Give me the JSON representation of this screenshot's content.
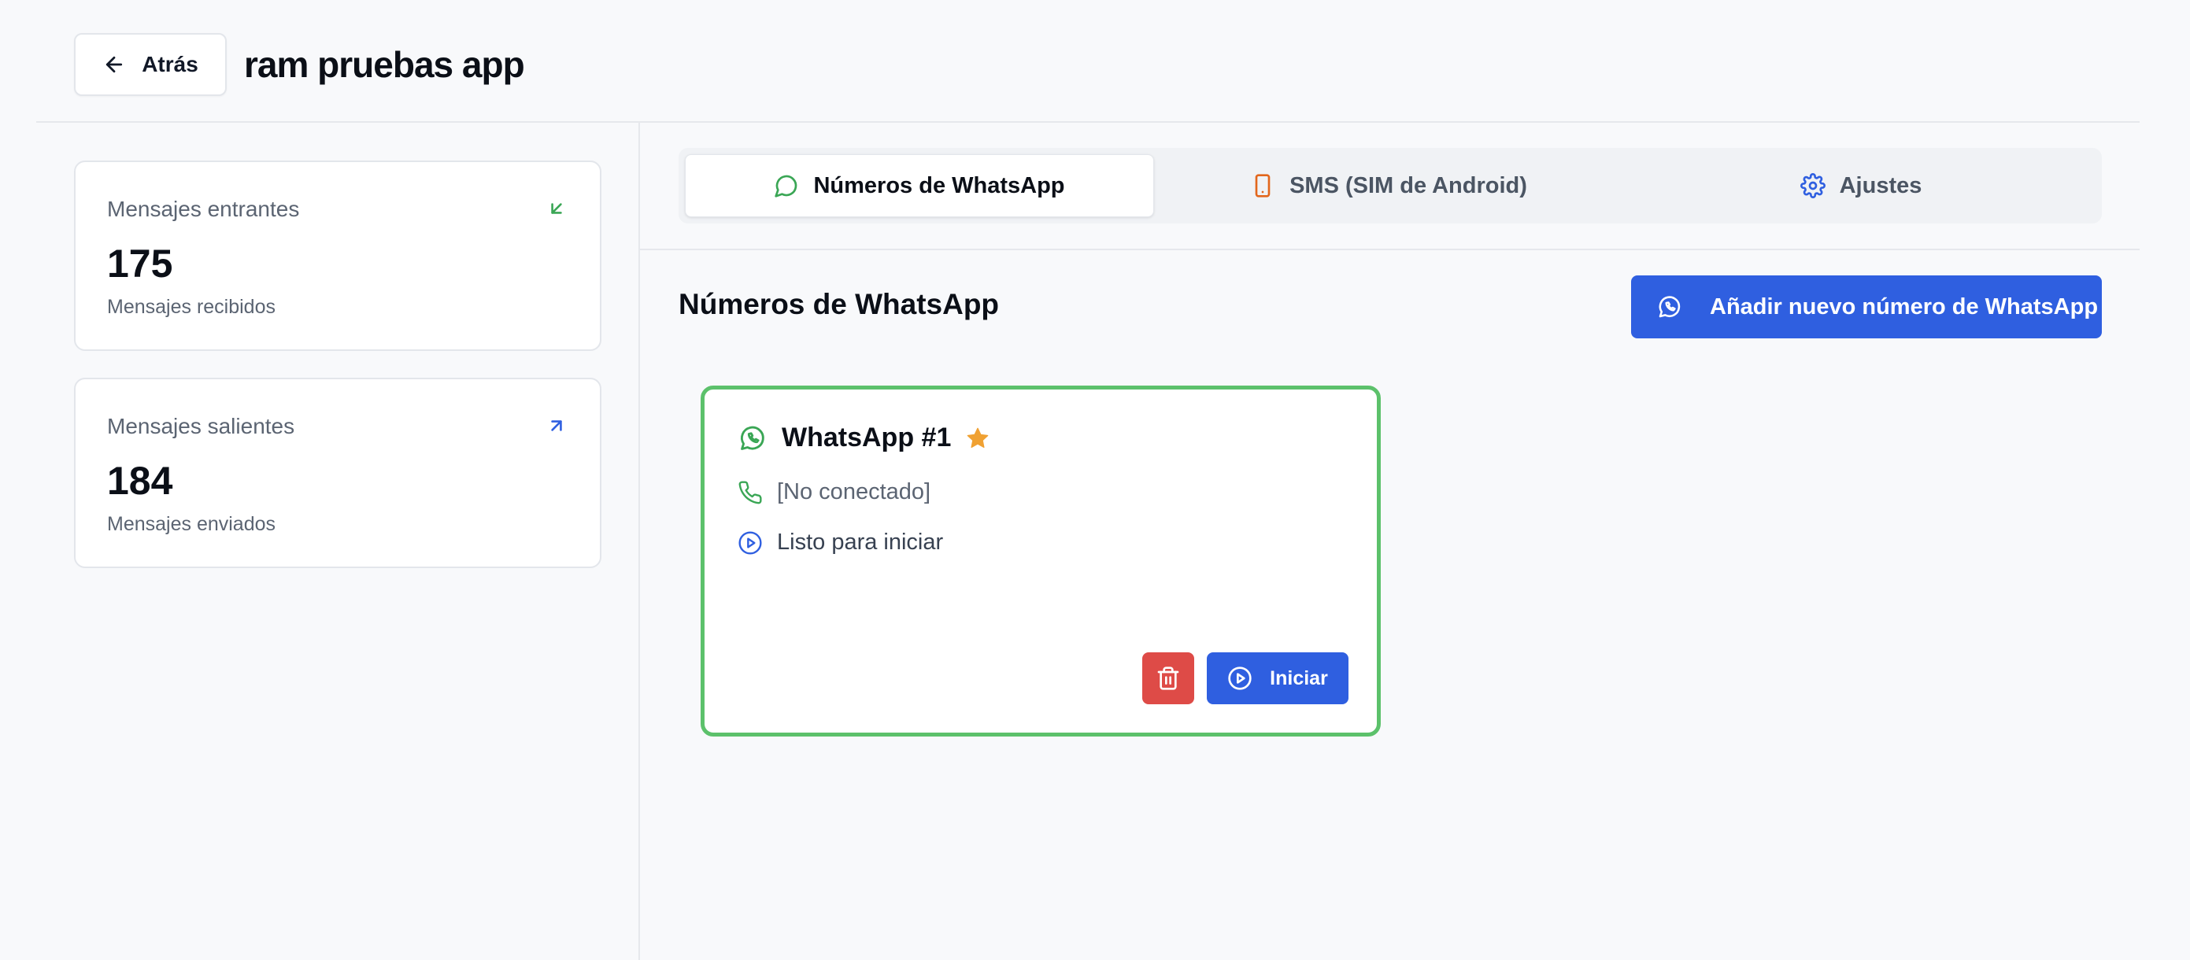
{
  "header": {
    "back_label": "Atrás",
    "title": "ram pruebas app"
  },
  "stats": {
    "incoming": {
      "label": "Mensajes entrantes",
      "value": "175",
      "sub": "Mensajes recibidos",
      "icon": "arrow-down-left-icon",
      "color": "#3aa655"
    },
    "outgoing": {
      "label": "Mensajes salientes",
      "value": "184",
      "sub": "Mensajes enviados",
      "icon": "arrow-up-right-icon",
      "color": "#2f5fe0"
    }
  },
  "tabs": [
    {
      "label": "Números de WhatsApp",
      "icon": "message-circle-icon",
      "active": true,
      "color": "#3aa655"
    },
    {
      "label": "SMS (SIM de Android)",
      "icon": "smartphone-icon",
      "active": false,
      "color": "#e2661c"
    },
    {
      "label": "Ajustes",
      "icon": "gear-icon",
      "active": false,
      "color": "#2f5fe0"
    }
  ],
  "section": {
    "title": "Números de WhatsApp",
    "add_button": "Añadir nuevo número de WhatsApp"
  },
  "whatsapp_card": {
    "name": "WhatsApp #1",
    "phone": "[No conectado]",
    "status": "Listo para iniciar",
    "start_button": "Iniciar",
    "border_color": "#5cc16b",
    "star_color": "#f0a132"
  }
}
